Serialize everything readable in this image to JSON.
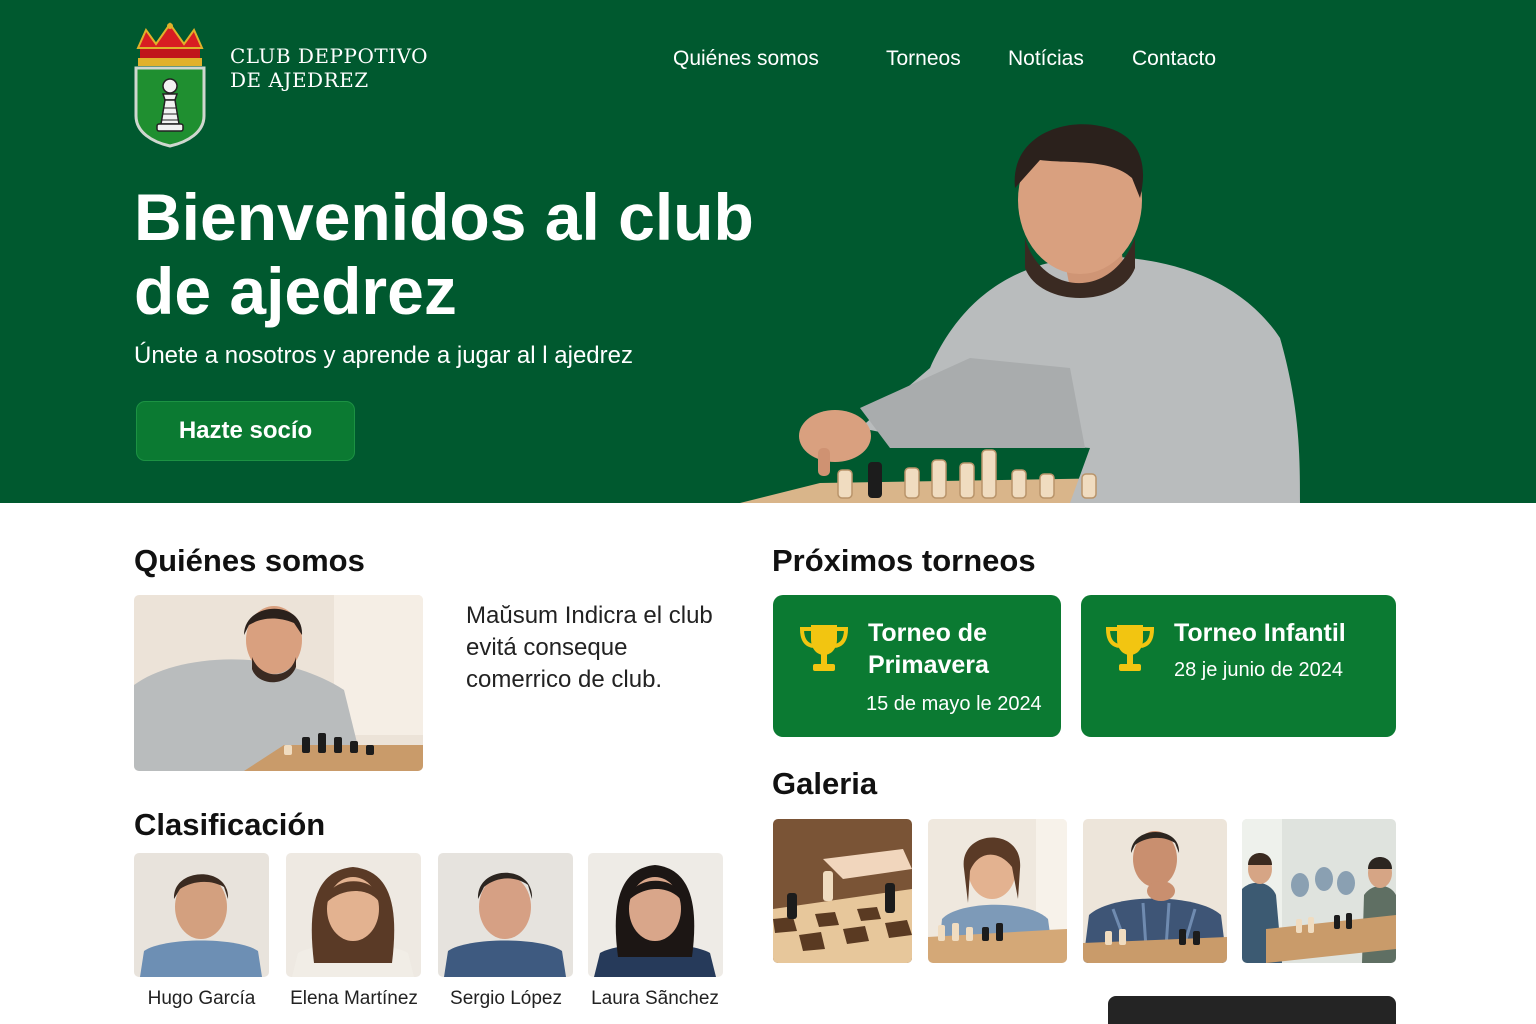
{
  "header": {
    "club_name_line1": "CLUB DEPPOTIVO",
    "club_name_line2": "DE AJEDREZ",
    "nav": [
      "Quiénes somos",
      "Torneos",
      "Notícias",
      "Contacto"
    ]
  },
  "hero": {
    "title_line1": "Bienvenidos al club",
    "title_line2": "de ajedrez",
    "subtitle": "Únete a nosotros y aprende a jugar al l ajedrez",
    "cta_label": "Hazte socío"
  },
  "about": {
    "heading": "Quiénes somos",
    "text": "Maŭsum Indicra el club evitá conseque comerrico de club."
  },
  "tournaments": {
    "heading": "Próximos torneos",
    "items": [
      {
        "name": "Torneo de Primavera",
        "date": "15 de mayo le 2024"
      },
      {
        "name": "Torneo Infantil",
        "date": "28 je junio de 2024"
      }
    ]
  },
  "ranking": {
    "heading": "Clasificación",
    "players": [
      "Hugo García",
      "Elena Martínez",
      "Sergio López",
      "Laura Sãnchez"
    ]
  },
  "gallery": {
    "heading": "Galeria"
  },
  "colors": {
    "brand_green": "#00592f",
    "card_green": "#0b7a32",
    "trophy_gold": "#f2c511"
  }
}
